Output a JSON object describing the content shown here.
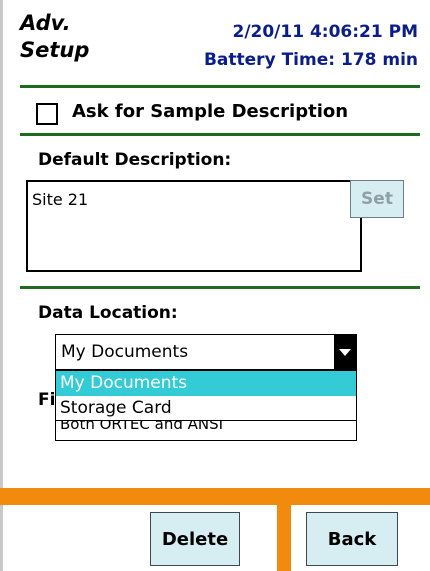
{
  "header": {
    "title_line1": "Adv.",
    "title_line2": "Setup",
    "datetime": "2/20/11 4:06:21 PM",
    "battery": "Battery Time: 178 min"
  },
  "sample_description": {
    "checkbox_label": "Ask for Sample Description",
    "checked": false
  },
  "default_description": {
    "label": "Default Description:",
    "value": "Site 21",
    "set_label": "Set"
  },
  "data_location": {
    "label": "Data Location:",
    "selected": "My Documents",
    "options": [
      "My Documents",
      "Storage Card"
    ]
  },
  "file_format": {
    "label_visible": "Fi",
    "selected_partial": "Both ORTEC and ANSI"
  },
  "buttons": {
    "delete": "Delete",
    "back": "Back"
  },
  "colors": {
    "header_blue": "#0b1d8c",
    "rule_green": "#1d6b1d",
    "accent_orange": "#f28a0d",
    "highlight_cyan": "#33cbd6",
    "button_bg": "#d6eef2"
  }
}
